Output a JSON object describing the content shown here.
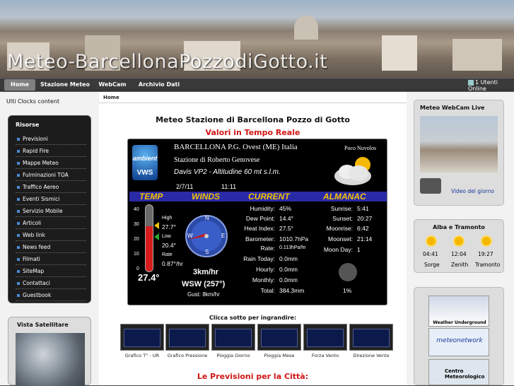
{
  "site": {
    "title": "Meteo-BarcellonaPozzodiGotto.it",
    "online": "1 Utenti Online"
  },
  "nav": [
    "Home",
    "Stazione Meteo",
    "WebCam",
    "Archivio Dati"
  ],
  "breadcrumb": "Home",
  "left": {
    "clocks": "Ulti Clocks content",
    "risorse_title": "Risorse",
    "risorse": [
      "Previsioni",
      "Rapid Fire",
      "Mappe Meteo",
      "Fulminazioni TOA",
      "Traffico Aereo",
      "Eventi Sismici",
      "Servizio Mobile",
      "Articoli",
      "Web link",
      "News feed",
      "Filmati",
      "SiteMap",
      "Contattaci",
      "Guestbook"
    ],
    "satellite_title": "Vista Satellitare"
  },
  "main": {
    "title": "Meteo Stazione di Barcellona Pozzo di Gotto",
    "subtitle": "Valori in Tempo Reale",
    "click_label": "Clicca sotto per ingrandire:",
    "forecast_title": "Le Previsioni per la Città:"
  },
  "station": {
    "logo_top": "ambient",
    "logo_bottom": "VWS",
    "line1": "BARCELLONA P.G. Ovest (ME) Italia",
    "line2": "Stazione di Roberto Genovese",
    "line3": "Davis VP2  -  Altitudine 60 mt s.l.m.",
    "date": "2/7/11",
    "time": "11:11",
    "condition": "Poco Nuvolos",
    "headers": [
      "TEMP",
      "WINDS",
      "CURRENT",
      "ALMANAC"
    ],
    "scale": [
      "40",
      "30",
      "20",
      "10",
      "0"
    ],
    "high_label": "High",
    "high": "27.7°",
    "low_label": "Low",
    "low": "20.4°",
    "rate_label": "Rate",
    "rate": "0.87°/hr",
    "temp": "27.4°",
    "compass": [
      "N",
      "E",
      "S",
      "W"
    ],
    "wind_speed": "3km/hr",
    "wind_dir": "WSW (257°)",
    "gust": "Gust:  8km/hr",
    "current": [
      {
        "label": "Humidity:",
        "value": "45%"
      },
      {
        "label": "Dew Point:",
        "value": "14.4°"
      },
      {
        "label": "Heat Index:",
        "value": "27.5°"
      },
      {
        "label": "Barometer:",
        "value": "1010.7hPa"
      },
      {
        "label": "Rate:",
        "value": "0.113hPa/hr"
      },
      {
        "label": "Rain Today:",
        "value": "0.0mm"
      },
      {
        "label": "Hourly:",
        "value": "0.0mm"
      },
      {
        "label": "Monthly:",
        "value": "0.0mm"
      },
      {
        "label": "Total:",
        "value": "384.3mm"
      }
    ],
    "almanac": [
      {
        "label": "Sunrise:",
        "value": "5:41"
      },
      {
        "label": "Sunset:",
        "value": "20:27"
      },
      {
        "label": "Moonrise:",
        "value": "6:42"
      },
      {
        "label": "Moonset:",
        "value": "21:14"
      },
      {
        "label": "Moon Day:",
        "value": "1"
      }
    ],
    "moon_pct": "1%"
  },
  "graphs": [
    "Grafico T° - UR",
    "Grafico Pressione",
    "Pioggia Giorno",
    "Pioggia Mese",
    "Forza Vento",
    "Direzione Vento"
  ],
  "right": {
    "webcam_title": "Meteo WebCam Live",
    "video_label": "Video del giorno",
    "sun_title": "Alba e Tramonto",
    "sun_times": [
      "04:41",
      "12:04",
      "19:27"
    ],
    "sun_labels": [
      "Sorge",
      "Zenith",
      "Tramonto"
    ],
    "partners": [
      "Weather Underground",
      "meteonetwork",
      "Centro Meteorologico"
    ]
  }
}
